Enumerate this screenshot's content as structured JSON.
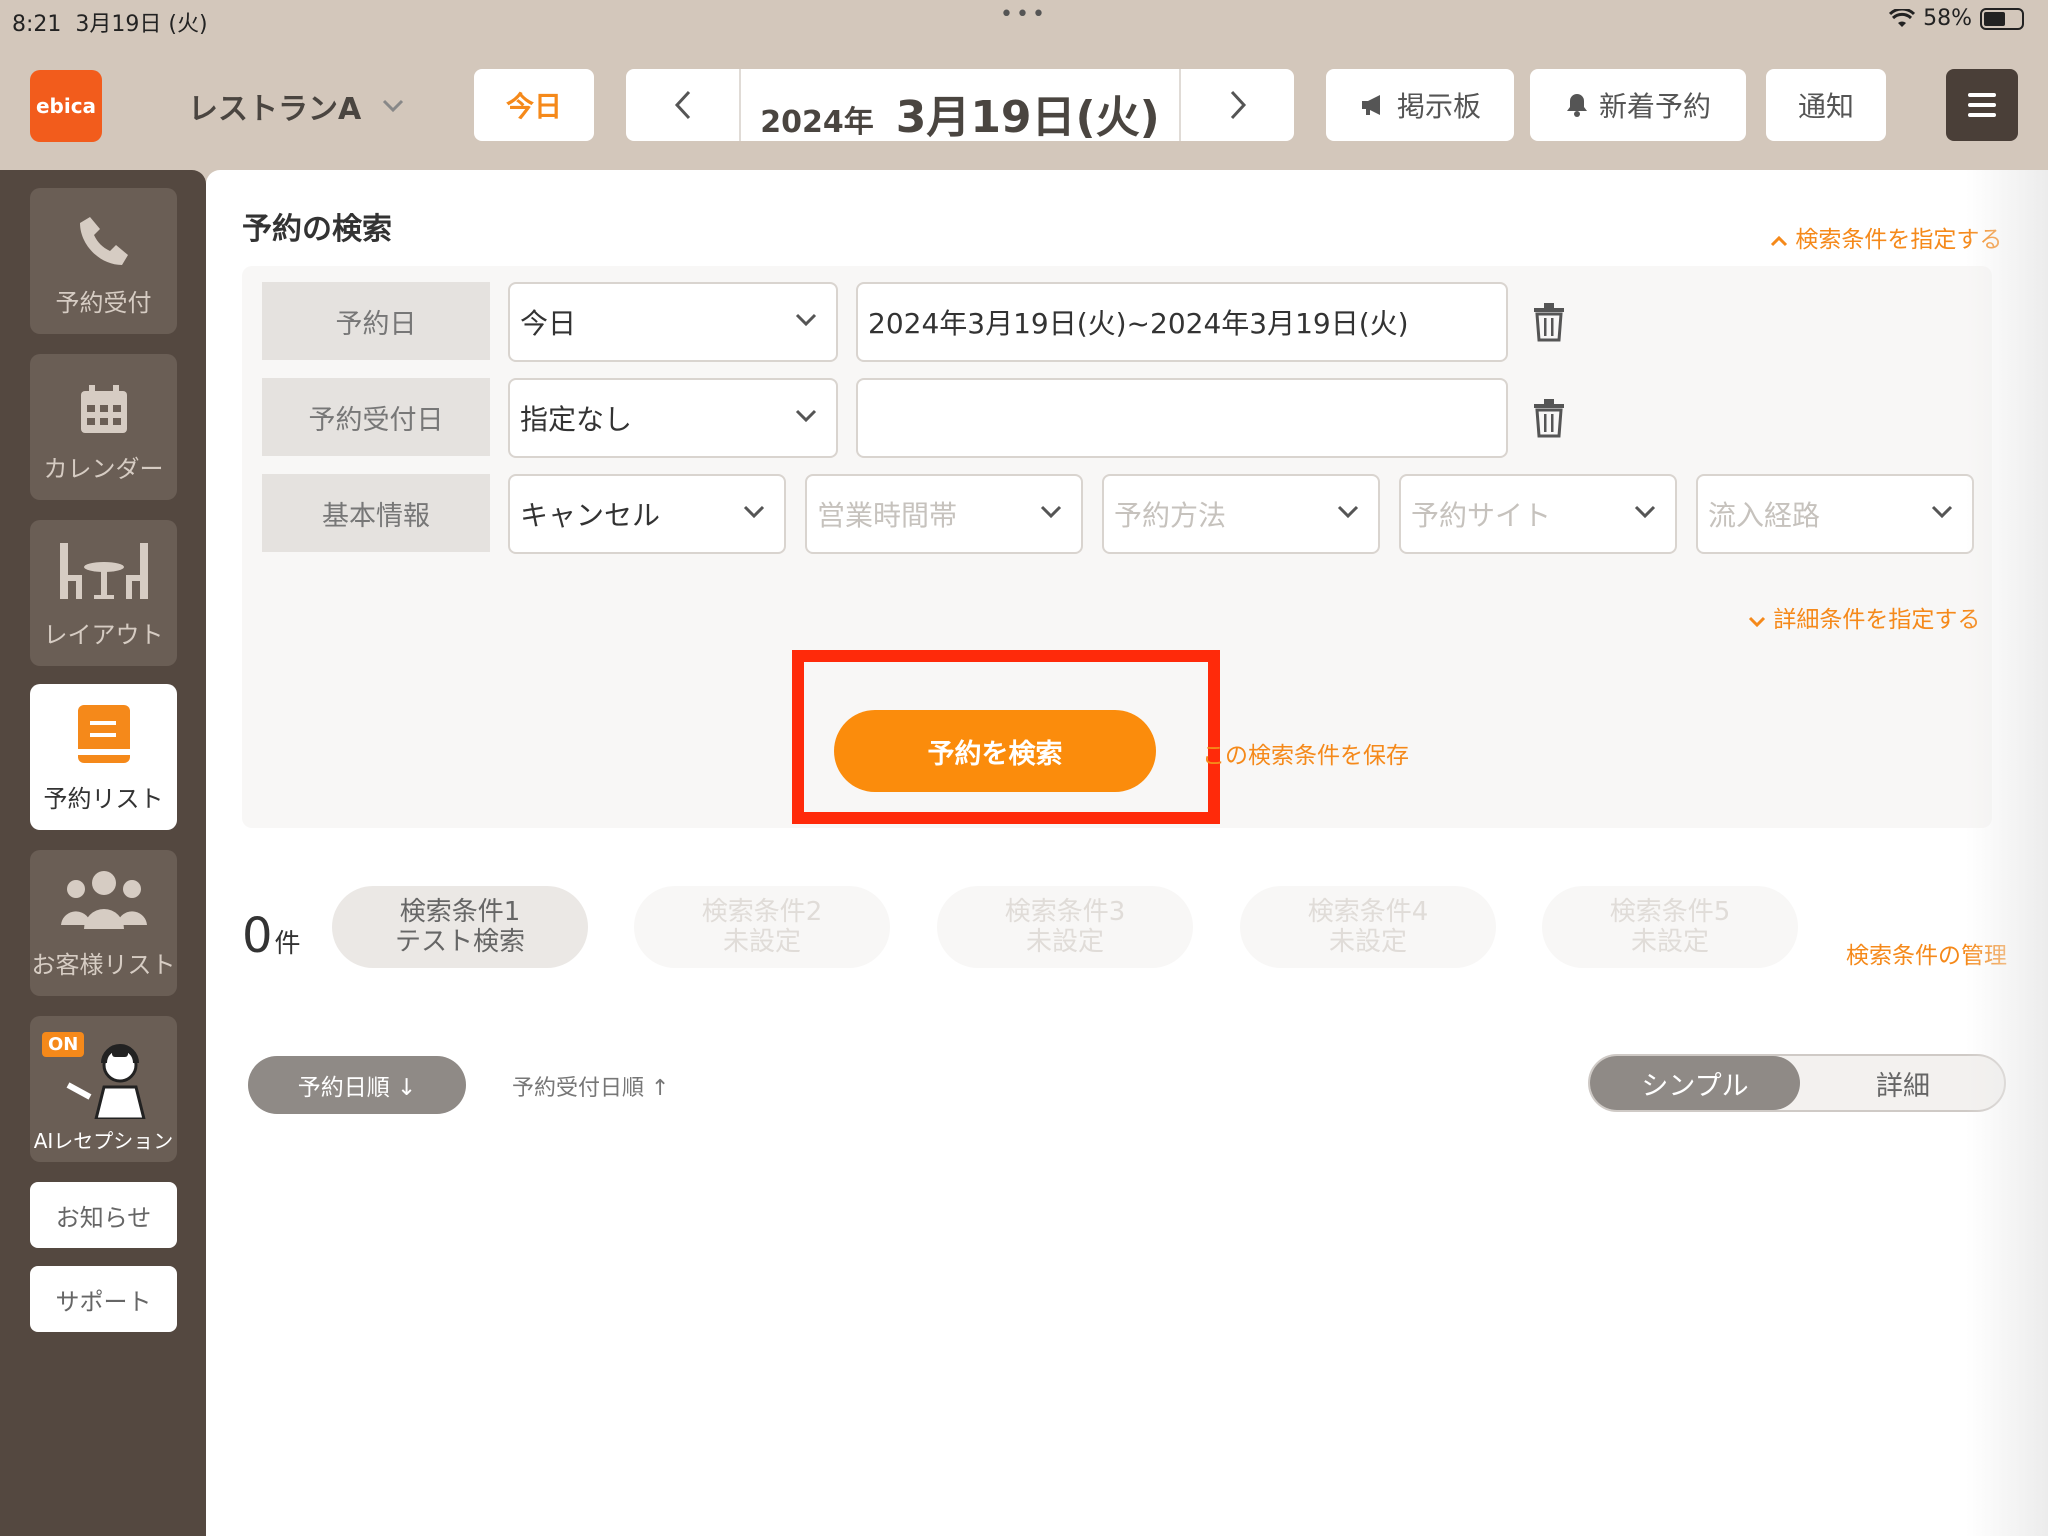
{
  "status_bar": {
    "time": "8:21",
    "date": "3月19日 (火)",
    "dots": "•••",
    "battery": "58%",
    "battery_level": 0.58
  },
  "header": {
    "logo": "ebica",
    "restaurant": "レストランA",
    "today": "今日",
    "date_year": "2024年",
    "date_monthday": "3月19日(火)",
    "board": "掲示板",
    "new_reservation": "新着予約",
    "notification": "通知"
  },
  "sidebar": {
    "items": [
      {
        "label": "予約受付",
        "icon": "phone-icon"
      },
      {
        "label": "カレンダー",
        "icon": "calendar-icon"
      },
      {
        "label": "レイアウト",
        "icon": "table-layout-icon"
      },
      {
        "label": "予約リスト",
        "icon": "reservation-list-icon"
      },
      {
        "label": "お客様リスト",
        "icon": "customers-icon"
      },
      {
        "label": "AIレセプション",
        "icon": "ai-receptionist-icon",
        "badge": "ON"
      }
    ],
    "news": "お知らせ",
    "support": "サポート"
  },
  "main": {
    "title": "予約の検索",
    "toggle_conditions": "検索条件を指定する",
    "rows": {
      "reservation_date": {
        "label": "予約日",
        "select": "今日",
        "value": "2024年3月19日(火)~2024年3月19日(火)"
      },
      "accept_date": {
        "label": "予約受付日",
        "select": "指定なし",
        "value": ""
      },
      "basic_info": {
        "label": "基本情報",
        "selects": [
          "キャンセル",
          "営業時間帯",
          "予約方法",
          "予約サイト",
          "流入経路"
        ]
      }
    },
    "detail_conditions": "詳細条件を指定する",
    "search_button": "予約を検索",
    "save_conditions": "この検索条件を保存",
    "count": "0",
    "count_unit": "件",
    "conditions": [
      {
        "title": "検索条件1",
        "sub": "テスト検索"
      },
      {
        "title": "検索条件2",
        "sub": "未設定"
      },
      {
        "title": "検索条件3",
        "sub": "未設定"
      },
      {
        "title": "検索条件4",
        "sub": "未設定"
      },
      {
        "title": "検索条件5",
        "sub": "未設定"
      }
    ],
    "manage_conditions": "検索条件の管理",
    "sort_active": "予約日順 ↓",
    "sort_other": "予約受付日順 ↑",
    "view_simple": "シンプル",
    "view_detail": "詳細"
  },
  "colors": {
    "accent": "#f5891a",
    "highlight": "#ff2a0a",
    "sidebar": "#544840"
  }
}
